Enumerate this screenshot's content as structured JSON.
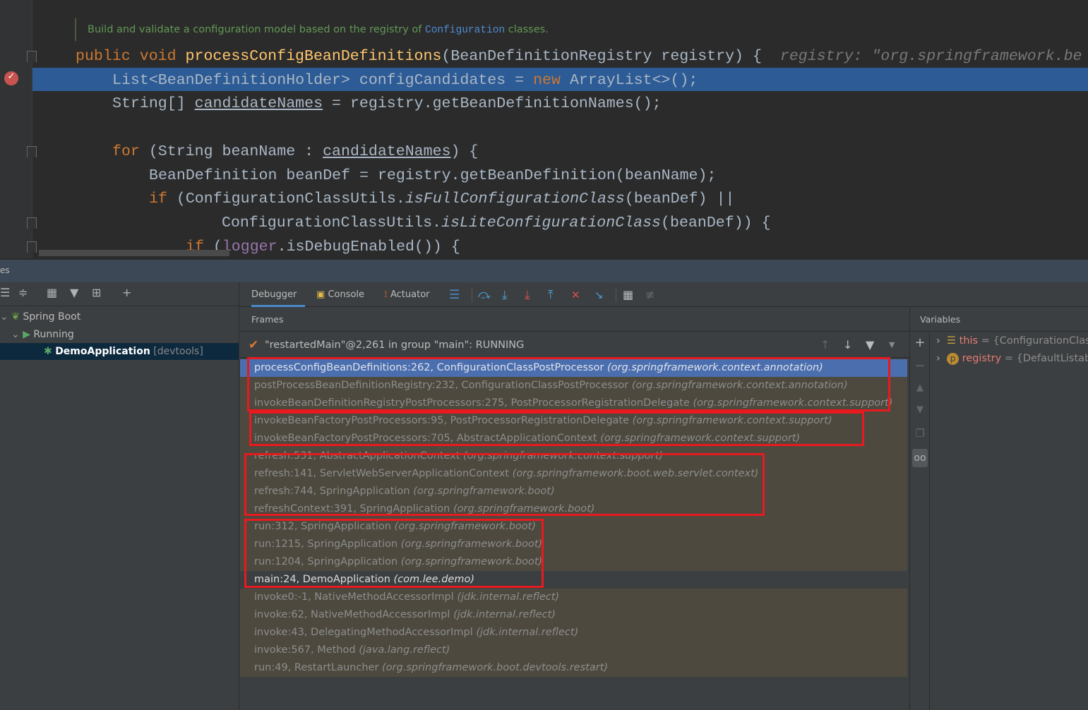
{
  "editor": {
    "doc_comment": {
      "before": "Build and validate a configuration model based on the registry of ",
      "code": "Configuration",
      "after": " classes."
    },
    "lines": [
      {
        "kw1": "public",
        "kw2": "void",
        "fn": "processConfigBeanDefinitions",
        "rest": "(BeanDefinitionRegistry registry) {",
        "hint": "registry: \"org.springframework.be"
      },
      {
        "text": "List<BeanDefinitionHolder> configCandidates = ",
        "kw": "new",
        "rest": " ArrayList<>();",
        "highlighted": true,
        "breakpoint": true
      },
      {
        "a": "String[] ",
        "ul": "candidateNames",
        "rest": " = registry.getBeanDefinitionNames();"
      },
      {
        "kw": "for",
        "a": " (String beanName : ",
        "ul": "candidateNames",
        "rest": ") {"
      },
      {
        "text": "BeanDefinition beanDef = registry.getBeanDefinition(beanName);"
      },
      {
        "kw": "if",
        "a": " (ConfigurationClassUtils.",
        "it": "isFullConfigurationClass",
        "rest": "(beanDef) ||"
      },
      {
        "a": "ConfigurationClassUtils.",
        "it": "isLiteConfigurationClass",
        "rest": "(beanDef)) {"
      },
      {
        "kw": "if",
        "a": " (",
        "field": "logger",
        "rest": ".isDebugEnabled()) {"
      }
    ]
  },
  "services": {
    "title_fragment": "es",
    "tree": [
      {
        "label": "Spring Boot",
        "icon": "spring-boot-icon"
      },
      {
        "label": "Running",
        "icon": "run-icon"
      },
      {
        "label": "DemoApplication",
        "suffix": "[devtools]",
        "icon": "bug-icon"
      }
    ]
  },
  "debugger": {
    "tabs": [
      {
        "label": "Debugger",
        "active": true
      },
      {
        "label": "Console",
        "icon": "console-icon"
      },
      {
        "label": "Actuator",
        "icon": "actuator-icon"
      }
    ],
    "frames_label": "Frames",
    "variables_label": "Variables",
    "thread": "\"restartedMain\"@2,261 in group \"main\": RUNNING",
    "frames": [
      {
        "method": "processConfigBeanDefinitions:262, ConfigurationClassPostProcessor",
        "pkg": "(org.springframework.context.annotation)",
        "state": "selected"
      },
      {
        "method": "postProcessBeanDefinitionRegistry:232, ConfigurationClassPostProcessor",
        "pkg": "(org.springframework.context.annotation)",
        "state": "library"
      },
      {
        "method": "invokeBeanDefinitionRegistryPostProcessors:275, PostProcessorRegistrationDelegate",
        "pkg": "(org.springframework.context.support)",
        "state": "library"
      },
      {
        "method": "invokeBeanFactoryPostProcessors:95, PostProcessorRegistrationDelegate",
        "pkg": "(org.springframework.context.support)",
        "state": "library"
      },
      {
        "method": "invokeBeanFactoryPostProcessors:705, AbstractApplicationContext",
        "pkg": "(org.springframework.context.support)",
        "state": "library"
      },
      {
        "method": "refresh:531, AbstractApplicationContext",
        "pkg": "(org.springframework.context.support)",
        "state": "library"
      },
      {
        "method": "refresh:141, ServletWebServerApplicationContext",
        "pkg": "(org.springframework.boot.web.servlet.context)",
        "state": "library"
      },
      {
        "method": "refresh:744, SpringApplication",
        "pkg": "(org.springframework.boot)",
        "state": "library"
      },
      {
        "method": "refreshContext:391, SpringApplication",
        "pkg": "(org.springframework.boot)",
        "state": "library"
      },
      {
        "method": "run:312, SpringApplication",
        "pkg": "(org.springframework.boot)",
        "state": "library"
      },
      {
        "method": "run:1215, SpringApplication",
        "pkg": "(org.springframework.boot)",
        "state": "library"
      },
      {
        "method": "run:1204, SpringApplication",
        "pkg": "(org.springframework.boot)",
        "state": "library"
      },
      {
        "method": "main:24, DemoApplication",
        "pkg": "(com.lee.demo)",
        "state": "user"
      },
      {
        "method": "invoke0:-1, NativeMethodAccessorImpl",
        "pkg": "(jdk.internal.reflect)",
        "state": "library"
      },
      {
        "method": "invoke:62, NativeMethodAccessorImpl",
        "pkg": "(jdk.internal.reflect)",
        "state": "library"
      },
      {
        "method": "invoke:43, DelegatingMethodAccessorImpl",
        "pkg": "(jdk.internal.reflect)",
        "state": "library"
      },
      {
        "method": "invoke:567, Method",
        "pkg": "(java.lang.reflect)",
        "state": "library"
      },
      {
        "method": "run:49, RestartLauncher",
        "pkg": "(org.springframework.boot.devtools.restart)",
        "state": "library"
      }
    ],
    "variables": [
      {
        "name": "this",
        "value": "{ConfigurationClass",
        "icon": "field-icon"
      },
      {
        "name": "registry",
        "value": "{DefaultListable",
        "icon": "parameter-icon",
        "badge": "p"
      }
    ]
  },
  "colors": {
    "selected_frame": "#4b6eaf",
    "library_frame": "#4d493e",
    "annotation_box": "#e8191f",
    "keyword": "#cc7832",
    "method": "#ffc66d"
  }
}
